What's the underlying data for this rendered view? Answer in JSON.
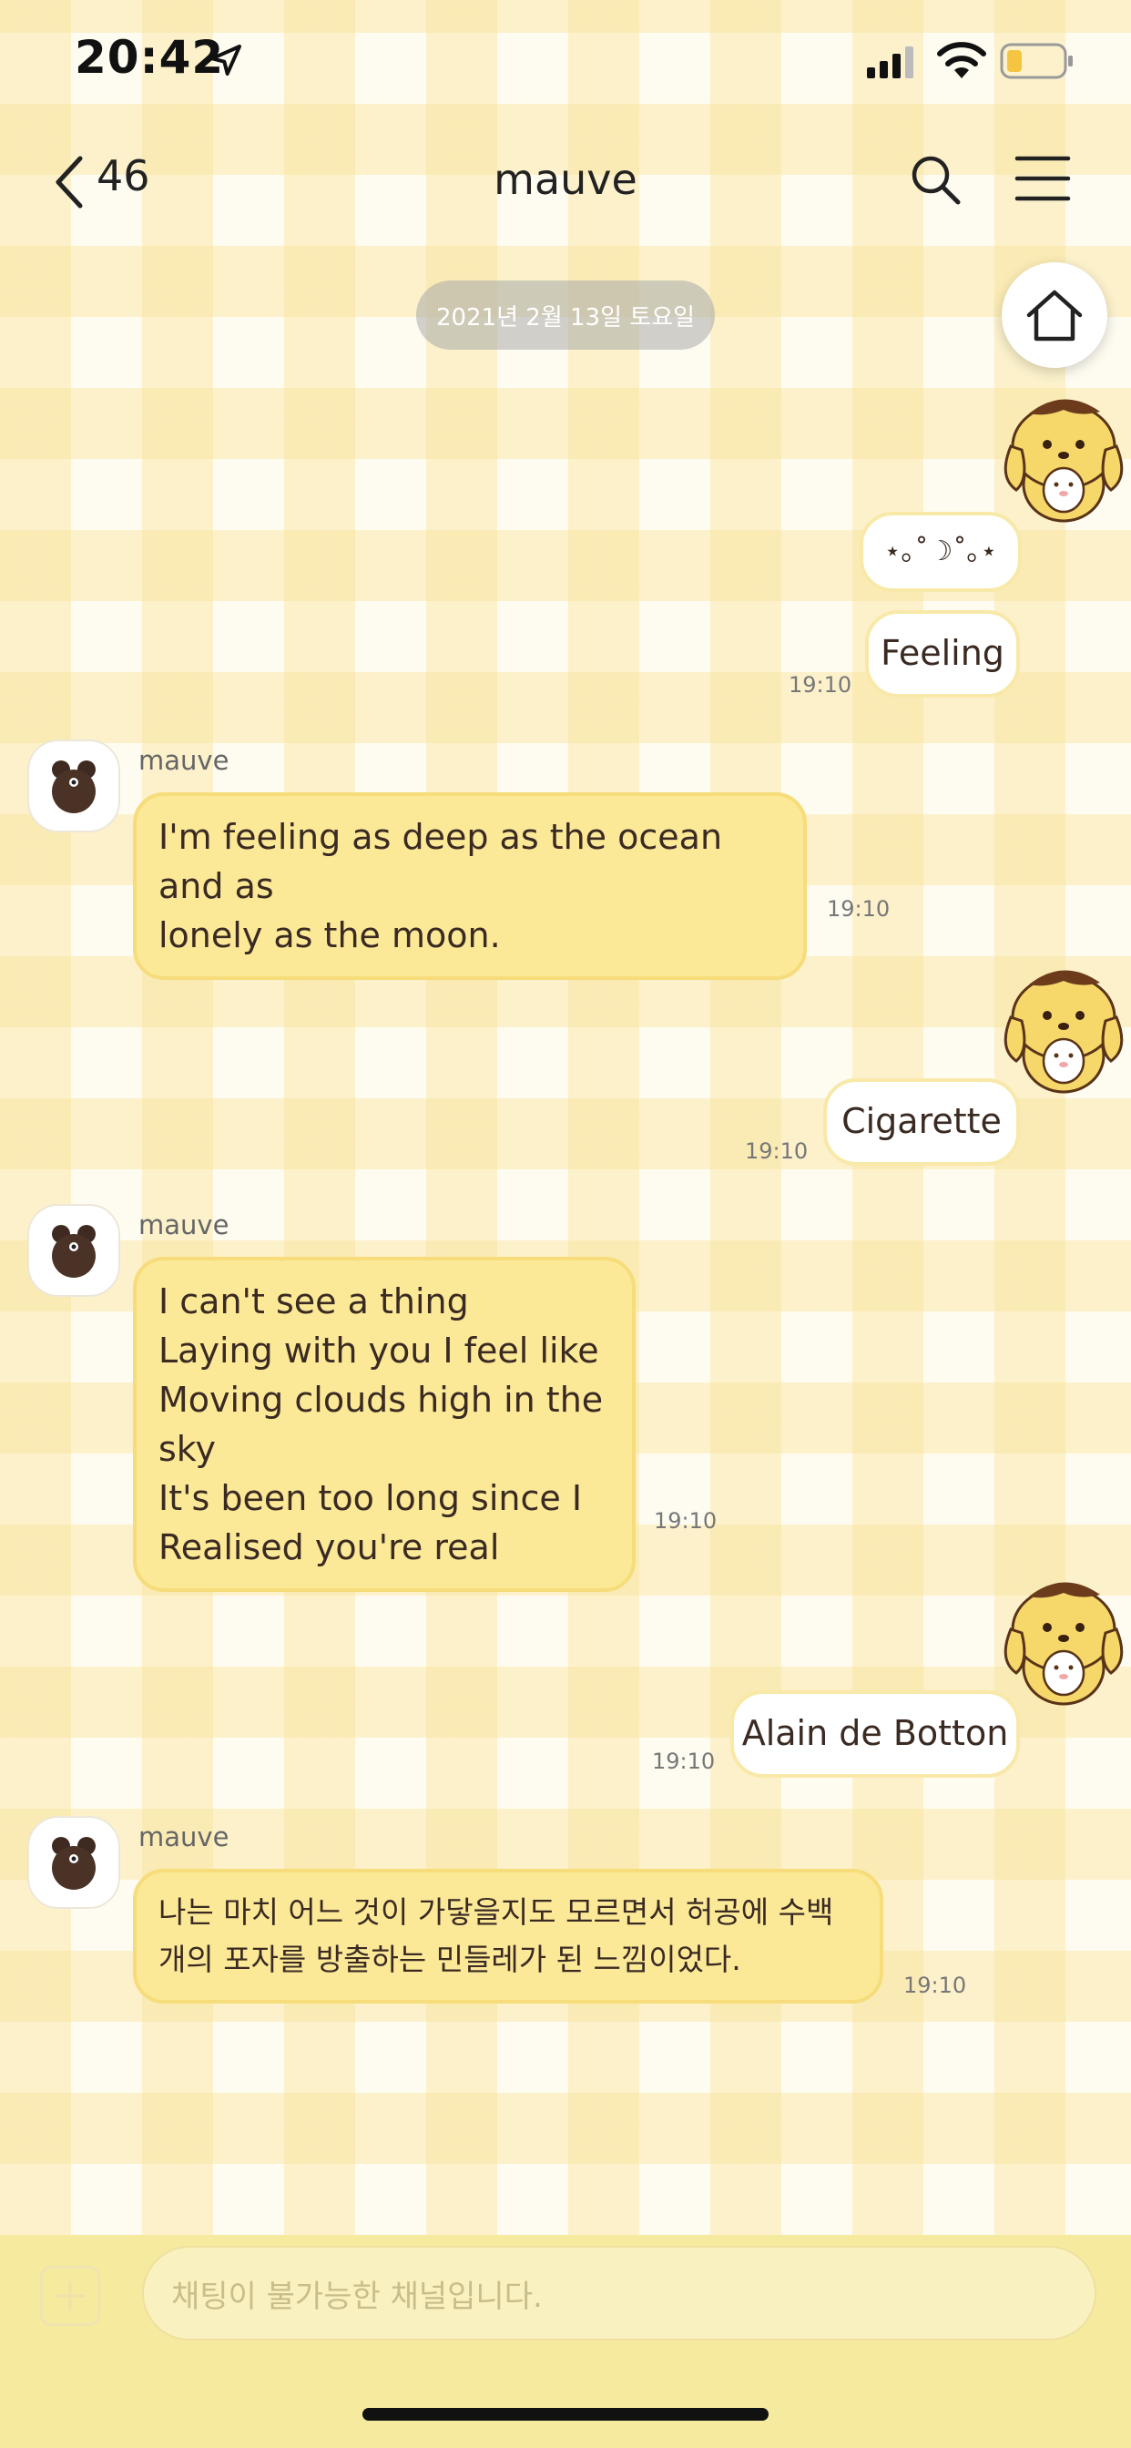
{
  "status_bar": {
    "time": "20:42"
  },
  "nav": {
    "back_count": "46",
    "title": "mauve"
  },
  "date_pill": "2021년 2월 13일 토요일",
  "messages": {
    "out_1": {
      "line1": "⋆｡˚☽˚｡⋆",
      "line2": "Feeling",
      "time": "19:10"
    },
    "in_1": {
      "sender": "mauve",
      "text": "I'm feeling as deep as the ocean and as\nlonely as the moon.",
      "time": "19:10"
    },
    "out_2": {
      "text": "Cigarette",
      "time": "19:10"
    },
    "in_2": {
      "sender": "mauve",
      "text": "I can't see a thing\nLaying with you I feel like\nMoving clouds high in the sky\nIt's been too long since I\nRealised you're real",
      "time": "19:10"
    },
    "out_3": {
      "text": "Alain de Botton",
      "time": "19:10"
    },
    "in_3": {
      "sender": "mauve",
      "text": "나는 마치 어느 것이 가닿을지도 모르면서 허공에 수백\n개의 포자를 방출하는 민들레가 된 느낌이었다.",
      "time": "19:10"
    }
  },
  "input": {
    "placeholder": "채팅이 불가능한 채널입니다."
  },
  "colors": {
    "accent": "#fbe998",
    "bubble_border": "#f6dc7a",
    "input_bar": "#f6ea9f"
  }
}
